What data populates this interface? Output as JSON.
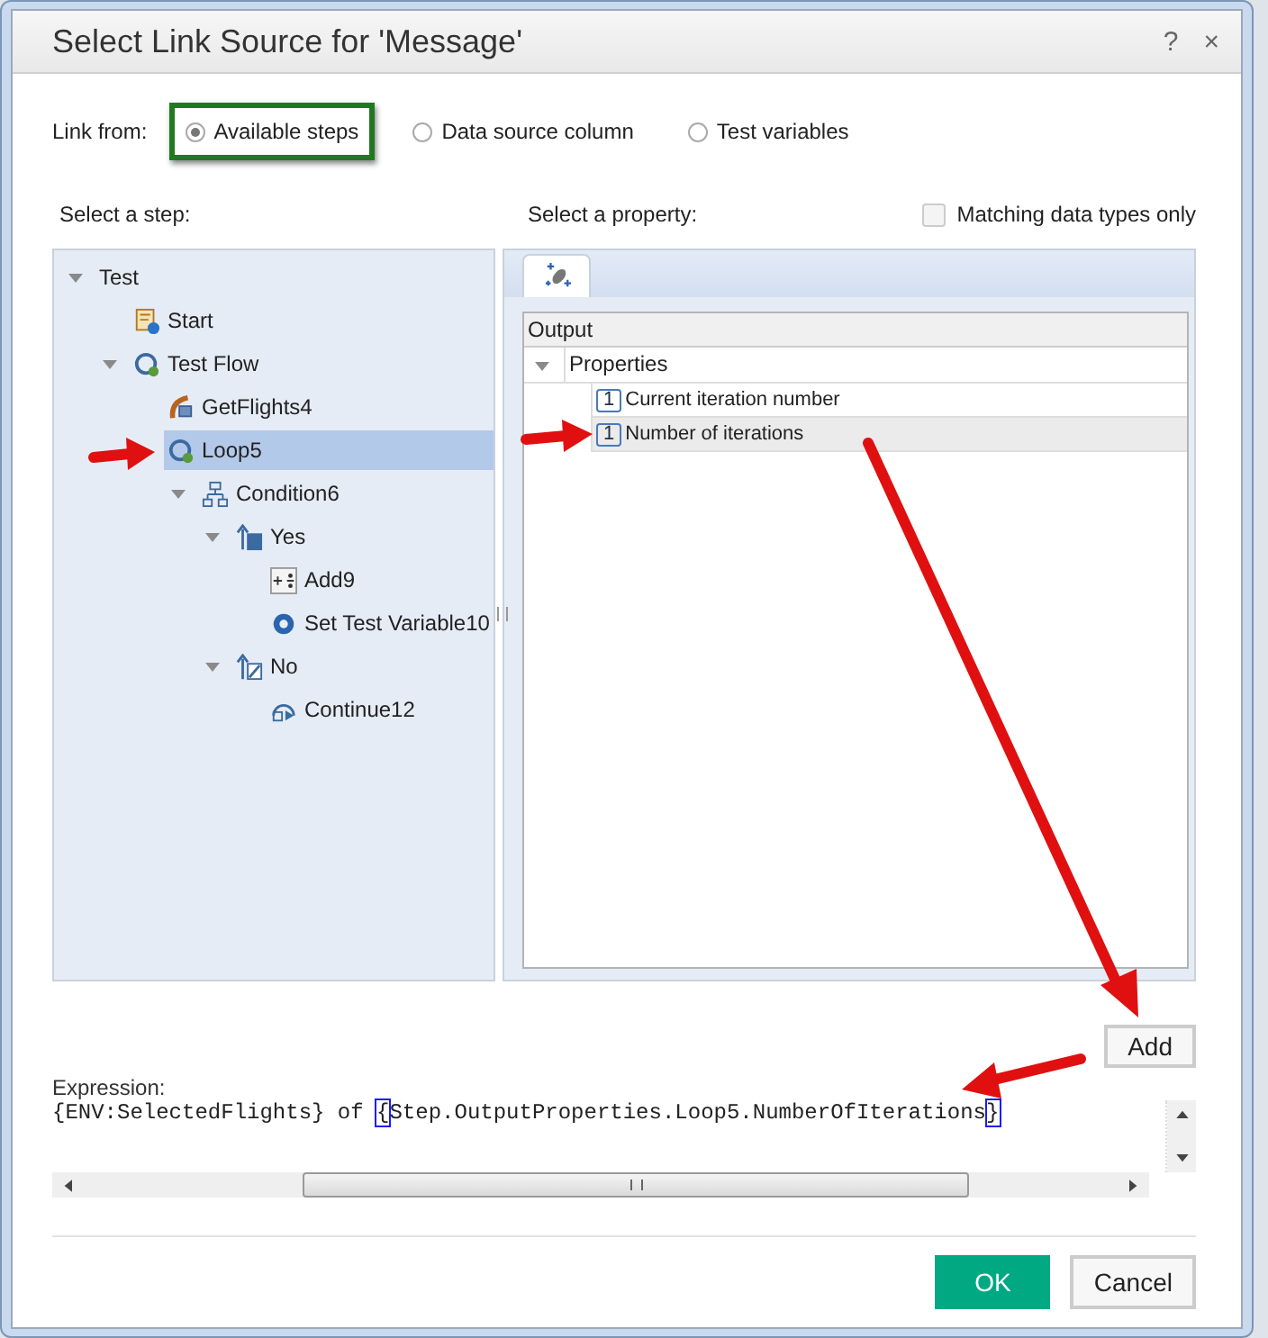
{
  "window": {
    "title": "Select Link Source for 'Message'",
    "buttons": [
      "?",
      "×"
    ]
  },
  "link_from": {
    "label": "Link from:",
    "options": [
      {
        "label": "Available steps",
        "selected": true,
        "highlighted": true
      },
      {
        "label": "Data source column",
        "selected": false,
        "highlighted": false
      },
      {
        "label": "Test variables",
        "selected": false,
        "highlighted": false
      }
    ]
  },
  "steps": {
    "label": "Select a step:",
    "tree": [
      {
        "label": "Test",
        "expanded": true,
        "selected": false,
        "children": [
          {
            "label": "Start",
            "kind": "start",
            "selected": false
          },
          {
            "label": "Test Flow",
            "kind": "flow",
            "expanded": true,
            "selected": false,
            "children": [
              {
                "label": "GetFlights4",
                "kind": "service",
                "selected": false
              },
              {
                "label": "Loop5",
                "kind": "loop",
                "selected": true,
                "pointed": true,
                "children": [
                  {
                    "label": "Condition6",
                    "kind": "condition",
                    "expanded": true,
                    "selected": false,
                    "children": [
                      {
                        "label": "Yes",
                        "kind": "yes",
                        "expanded": true,
                        "selected": false,
                        "children": [
                          {
                            "label": "Add9",
                            "kind": "add",
                            "selected": false
                          },
                          {
                            "label": "Set Test Variable10",
                            "kind": "variable",
                            "selected": false
                          }
                        ]
                      },
                      {
                        "label": "No",
                        "kind": "no",
                        "expanded": true,
                        "selected": false,
                        "children": [
                          {
                            "label": "Continue12",
                            "kind": "continue",
                            "selected": false
                          }
                        ]
                      }
                    ]
                  }
                ]
              }
            ]
          }
        ]
      }
    ]
  },
  "properties": {
    "label": "Select a property:",
    "matching_only": {
      "label": "Matching data types only",
      "checked": false
    },
    "grid_header": "Output",
    "group": {
      "label": "Properties",
      "expanded": true
    },
    "items": [
      {
        "label": "Current iteration number",
        "badge": "1",
        "selected": false
      },
      {
        "label": "Number of iterations",
        "badge": "1",
        "selected": true,
        "pointed": true
      }
    ]
  },
  "add_button": "Add",
  "expression": {
    "label": "Expression:",
    "parts": [
      {
        "text": "{ENV:SelectedFlights} of ",
        "highlighted": false
      },
      {
        "text": "{",
        "highlighted": true
      },
      {
        "text": "Step.OutputProperties.Loop5.NumberOfIterations",
        "highlighted": false
      },
      {
        "text": "}",
        "highlighted": true
      }
    ]
  },
  "buttons": [
    {
      "label": "OK",
      "kind": "primary"
    },
    {
      "label": "Cancel",
      "kind": "secondary"
    }
  ]
}
